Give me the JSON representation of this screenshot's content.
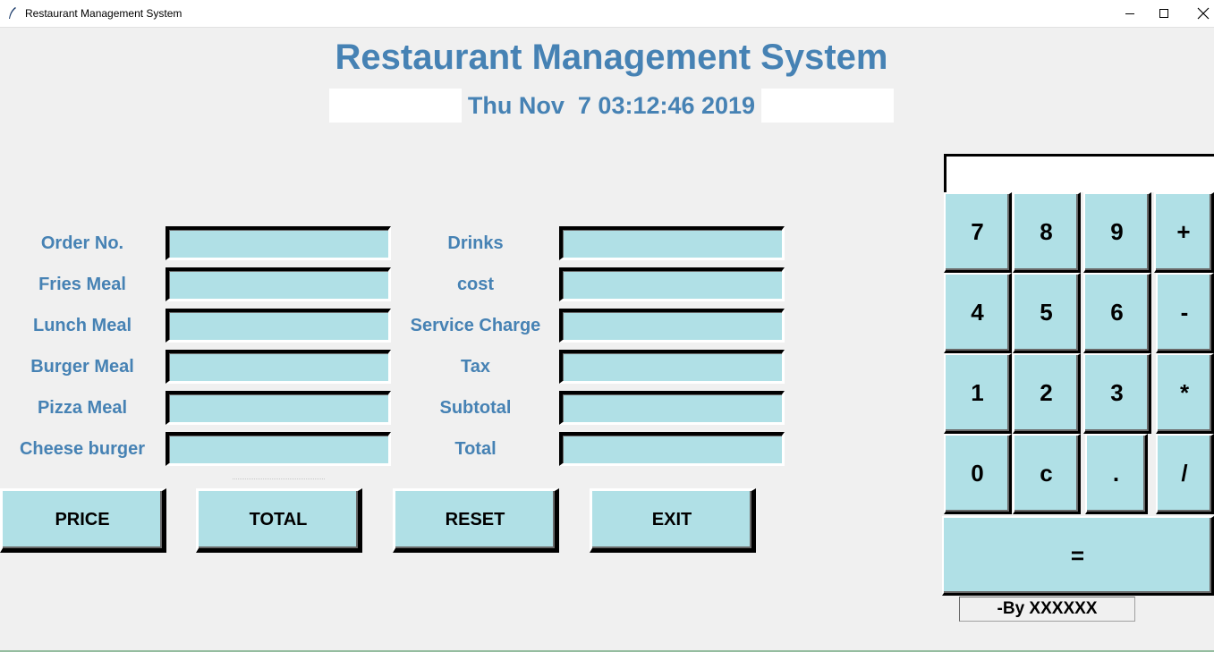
{
  "window": {
    "title": "Restaurant Management System",
    "controls": {
      "minimize": "minimize-icon",
      "maximize": "maximize-icon",
      "close": "close-icon"
    }
  },
  "header": {
    "title": "Restaurant Management System",
    "datetime": "Thu Nov  7 03:12:46 2019"
  },
  "left_fields": [
    {
      "label": "Order No.",
      "value": ""
    },
    {
      "label": "Fries Meal",
      "value": ""
    },
    {
      "label": "Lunch Meal",
      "value": ""
    },
    {
      "label": "Burger Meal",
      "value": ""
    },
    {
      "label": "Pizza Meal",
      "value": ""
    },
    {
      "label": "Cheese burger",
      "value": ""
    }
  ],
  "right_fields": [
    {
      "label": "Drinks",
      "value": ""
    },
    {
      "label": "cost",
      "value": ""
    },
    {
      "label": "Service Charge",
      "value": ""
    },
    {
      "label": "Tax",
      "value": ""
    },
    {
      "label": "Subtotal",
      "value": ""
    },
    {
      "label": "Total",
      "value": ""
    }
  ],
  "buttons": {
    "price": "PRICE",
    "total": "TOTAL",
    "reset": "RESET",
    "exit": "EXIT"
  },
  "calculator": {
    "display": "",
    "keys": [
      "7",
      "8",
      "9",
      "+",
      "4",
      "5",
      "6",
      "-",
      "1",
      "2",
      "3",
      "*",
      "0",
      "c",
      ".",
      "/"
    ],
    "equals": "="
  },
  "footer": {
    "byline": "-By XXXXXX"
  },
  "colors": {
    "accent": "#4682b4",
    "field_bg": "#b0e0e6",
    "window_bg": "#f0f0f0"
  }
}
